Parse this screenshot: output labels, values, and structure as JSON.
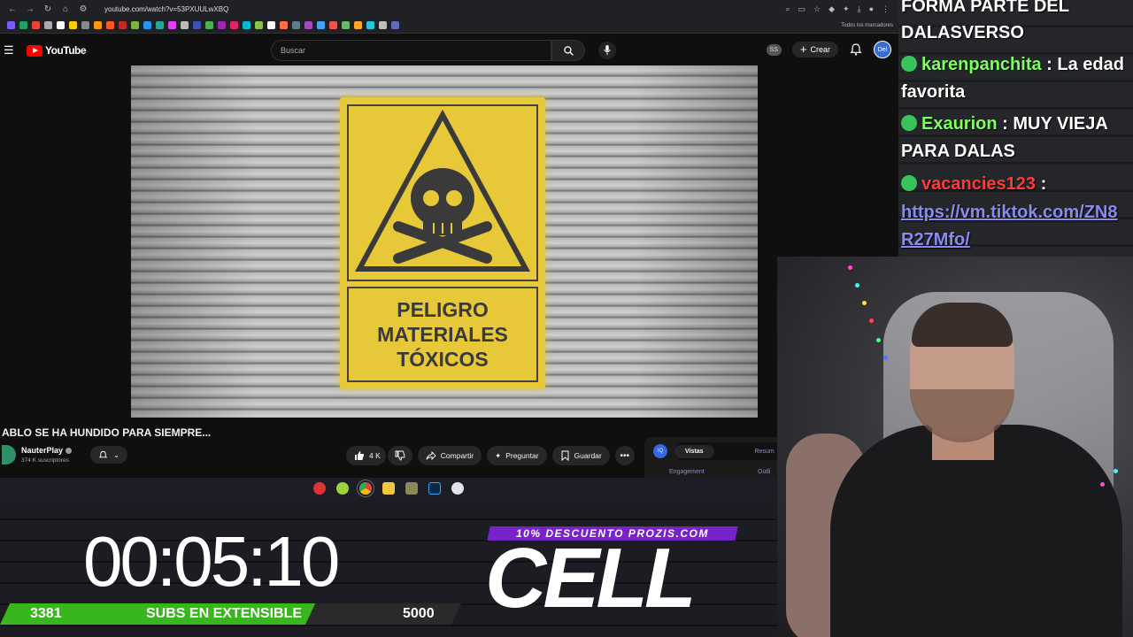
{
  "browser": {
    "url": "youtube.com/watch?v=53PXUULwXBQ",
    "bookmarks_folder": "Todos los marcadores"
  },
  "youtube": {
    "logo_text": "YouTube",
    "search_placeholder": "Buscar",
    "ss_badge": "SS",
    "create_label": "Crear",
    "avatar_label": "Del"
  },
  "video": {
    "sign_lines": [
      "PELIGRO",
      "MATERIALES",
      "TÓXICOS"
    ],
    "title": "ABLO SE HA HUNDIDO PARA SIEMPRE...",
    "channel": "NauterPlay",
    "subscribers": "374 K suscriptores",
    "likes": "4 K",
    "share_label": "Compartir",
    "ask_label": "Preguntar",
    "save_label": "Guardar"
  },
  "extension": {
    "logo": "IQ",
    "tab_active": "Vistas",
    "tab_inactive": "Resum",
    "sub_left": "Engagement",
    "sub_right": "Outli"
  },
  "overlay": {
    "timer": "00:05:10",
    "subs_current": "3381",
    "subs_label": "SUBS EN EXTENSIBLE",
    "subs_goal": "5000",
    "subs_progress": 0.676,
    "promo": "10% DESCUENTO PROZIS.COM",
    "brand": "CELL"
  },
  "chat": {
    "lines": [
      {
        "text": "FORMA PARTE DEL"
      },
      {
        "text": "DALASVERSO"
      },
      {
        "user": "karenpanchita",
        "msg": ": La edad"
      },
      {
        "text": "favorita"
      },
      {
        "user": "Exaurion",
        "msg": ": MUY VIEJA"
      },
      {
        "text": "PARA DALAS"
      },
      {
        "user": "vacancies123",
        "msg": ":"
      },
      {
        "link": "https://vm.tiktok.com/ZN8"
      },
      {
        "link": "R27Mfo/"
      }
    ]
  },
  "colors": {
    "youtube_red": "#ff0000",
    "progress_green": "#38b61e",
    "promo_purple": "#7a22c9",
    "sign_yellow": "#e7c838"
  }
}
